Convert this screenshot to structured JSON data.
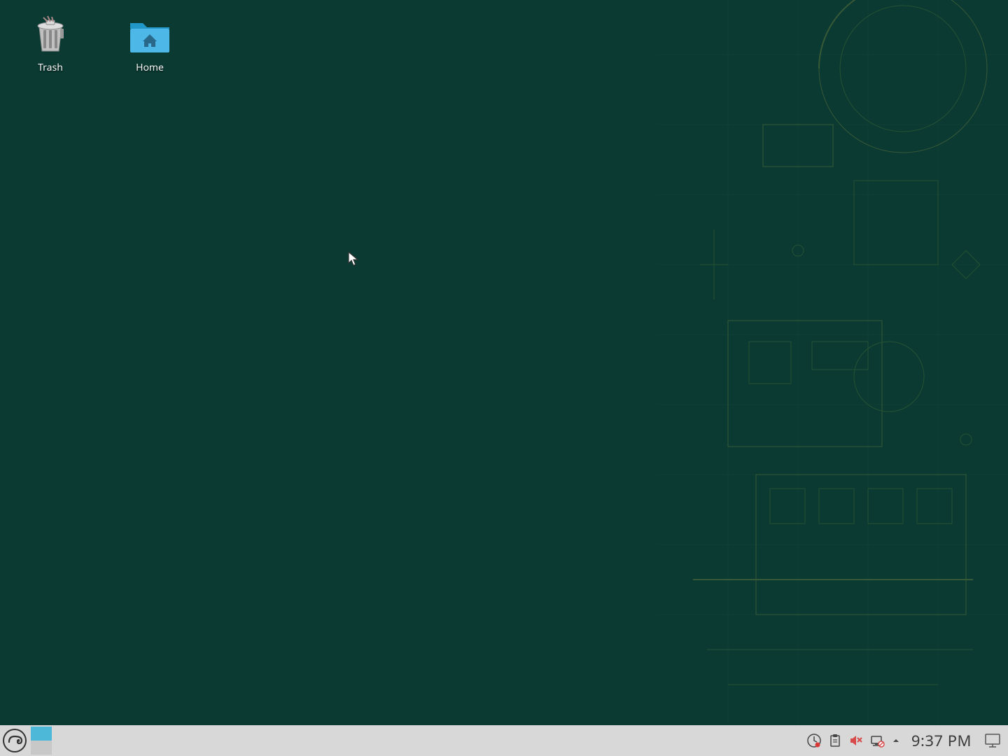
{
  "desktop": {
    "icons": [
      {
        "name": "trash",
        "label": "Trash"
      },
      {
        "name": "home",
        "label": "Home"
      }
    ]
  },
  "taskbar": {
    "clock": "9:37 PM",
    "tray_icons": {
      "updates": "updates-icon",
      "clipboard": "clipboard-icon",
      "volume": "volume-muted-icon",
      "network": "network-disconnected-icon"
    }
  },
  "colors": {
    "desktop_bg": "#0a3a32",
    "taskbar_bg": "#d8d8d8",
    "pager_active": "#4db8d8"
  }
}
